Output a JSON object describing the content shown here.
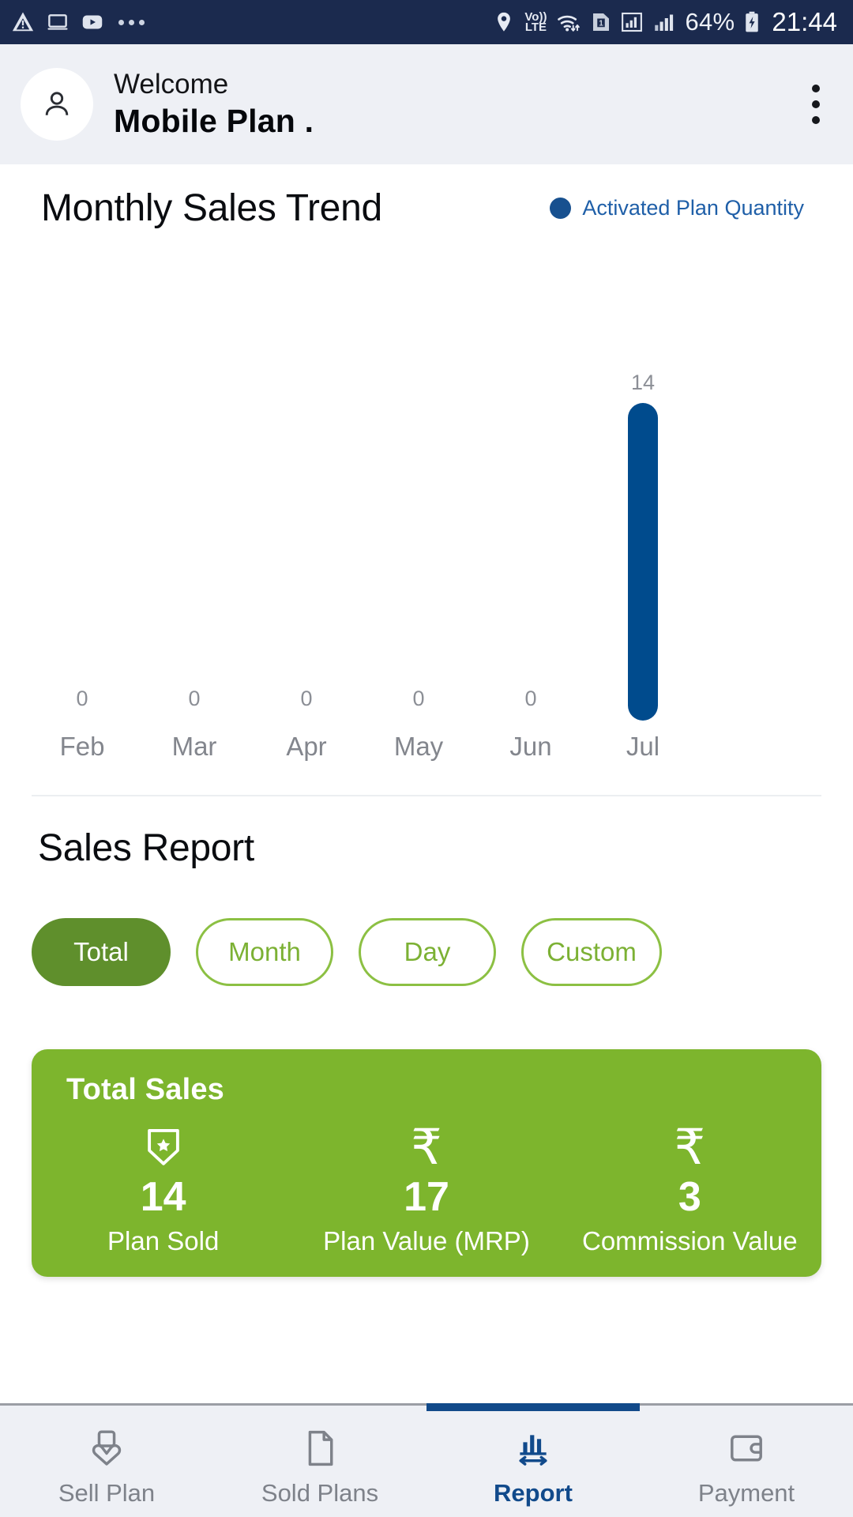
{
  "statusbar": {
    "left_icons": [
      "warning-icon",
      "laptop-icon",
      "youtube-icon",
      "more-dots-icon"
    ],
    "location_icon": "location-pin-icon",
    "volte_top": "Vo))",
    "volte_bottom": "LTE",
    "wifi_icon": "wifi-icon",
    "sim_label": "1",
    "signal_icon": "signal-bars-icon",
    "battery_percent": "64%",
    "battery_icon": "battery-charging-icon",
    "time": "21:44"
  },
  "header": {
    "avatar_icon": "user-avatar-icon",
    "welcome": "Welcome",
    "username": "Mobile Plan .",
    "menu_icon": "kebab-menu-icon"
  },
  "chart_data": {
    "type": "bar",
    "title": "Monthly Sales Trend",
    "categories": [
      "Feb",
      "Mar",
      "Apr",
      "May",
      "Jun",
      "Jul"
    ],
    "values": [
      0,
      0,
      0,
      0,
      0,
      14
    ],
    "value_labels": [
      "0",
      "0",
      "0",
      "0",
      "0",
      "14"
    ],
    "series": [
      {
        "name": "Activated Plan Quantity",
        "values": [
          0,
          0,
          0,
          0,
          0,
          14
        ],
        "color": "#004b8d"
      }
    ],
    "legend": {
      "label": "Activated Plan Quantity",
      "position": "top-right",
      "color": "#17508f"
    },
    "xlabel": "",
    "ylabel": "",
    "ylim": [
      0,
      14
    ],
    "grid": false
  },
  "report": {
    "title": "Sales Report",
    "filters": [
      {
        "label": "Total",
        "active": true
      },
      {
        "label": "Month",
        "active": false
      },
      {
        "label": "Day",
        "active": false
      },
      {
        "label": "Custom",
        "active": false
      }
    ]
  },
  "total_sales_card": {
    "title": "Total Sales",
    "accent_color": "#7db52d",
    "stats": [
      {
        "icon": "shield-star-icon",
        "value": "14",
        "label": "Plan Sold"
      },
      {
        "icon": "rupee-icon",
        "value": "17",
        "label": "Plan Value (MRP)"
      },
      {
        "icon": "rupee-icon",
        "value": "3",
        "label": "Commission Value"
      }
    ]
  },
  "bottom_nav": {
    "active_color": "#114a8b",
    "items": [
      {
        "label": "Sell Plan",
        "icon": "sell-plan-icon",
        "active": false
      },
      {
        "label": "Sold Plans",
        "icon": "document-icon",
        "active": false
      },
      {
        "label": "Report",
        "icon": "bar-chart-arrow-icon",
        "active": true
      },
      {
        "label": "Payment",
        "icon": "wallet-icon",
        "active": false
      }
    ]
  }
}
